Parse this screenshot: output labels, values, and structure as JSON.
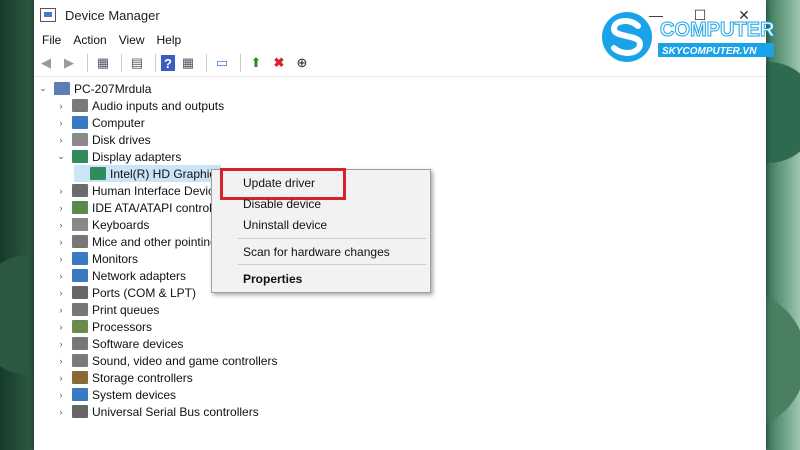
{
  "window": {
    "title": "Device Manager",
    "minimize": "—",
    "maximize": "☐",
    "close": "✕"
  },
  "menubar": [
    "File",
    "Action",
    "View",
    "Help"
  ],
  "toolbar": [
    "◀",
    "▶",
    "▦",
    "▤",
    "?",
    "▦",
    "▭",
    "⬆",
    "✖",
    "⊕"
  ],
  "tree": {
    "root": "PC-207Mrdula",
    "categories": [
      {
        "label": "Audio inputs and outputs",
        "icon": "speaker-icon",
        "color": "#7a7a7a"
      },
      {
        "label": "Computer",
        "icon": "monitor-icon",
        "color": "#3b79c4"
      },
      {
        "label": "Disk drives",
        "icon": "disk-icon",
        "color": "#8a8a8a"
      },
      {
        "label": "Display adapters",
        "icon": "display-adapter-icon",
        "color": "#2e8d5a"
      },
      {
        "label": "Intel(R) HD Graphics",
        "icon": "display-adapter-icon",
        "color": "#2e8d5a"
      },
      {
        "label": "Human Interface Device",
        "icon": "hid-icon",
        "color": "#6b6b6b"
      },
      {
        "label": "IDE ATA/ATAPI controller",
        "icon": "ide-icon",
        "color": "#5a8a4a"
      },
      {
        "label": "Keyboards",
        "icon": "keyboard-icon",
        "color": "#888"
      },
      {
        "label": "Mice and other pointing",
        "icon": "mouse-icon",
        "color": "#777"
      },
      {
        "label": "Monitors",
        "icon": "monitor-icon",
        "color": "#3b79c4"
      },
      {
        "label": "Network adapters",
        "icon": "network-icon",
        "color": "#3b79c4"
      },
      {
        "label": "Ports (COM & LPT)",
        "icon": "port-icon",
        "color": "#666"
      },
      {
        "label": "Print queues",
        "icon": "printer-icon",
        "color": "#777"
      },
      {
        "label": "Processors",
        "icon": "processor-icon",
        "color": "#6b8a4a"
      },
      {
        "label": "Software devices",
        "icon": "software-icon",
        "color": "#777"
      },
      {
        "label": "Sound, video and game controllers",
        "icon": "speaker-icon",
        "color": "#7a7a7a"
      },
      {
        "label": "Storage controllers",
        "icon": "storage-icon",
        "color": "#8a6a3a"
      },
      {
        "label": "System devices",
        "icon": "system-icon",
        "color": "#3b79c4"
      },
      {
        "label": "Universal Serial Bus controllers",
        "icon": "usb-icon",
        "color": "#666"
      }
    ]
  },
  "context_menu": {
    "update_driver": "Update driver",
    "disable_device": "Disable device",
    "uninstall_device": "Uninstall device",
    "scan": "Scan for hardware changes",
    "properties": "Properties"
  },
  "logo": {
    "brand": "COMPUTER",
    "site": "SKYCOMPUTER.VN"
  }
}
